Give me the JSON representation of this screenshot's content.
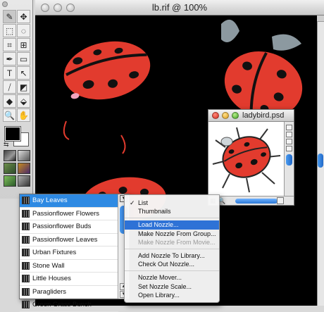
{
  "document_window": {
    "title": "lb.rif @ 100%"
  },
  "ladybird_window": {
    "title": "ladybird.psd"
  },
  "toolbox": {
    "tools": [
      "brush-icon",
      "move-icon",
      "marquee-icon",
      "lasso-icon",
      "crop-icon",
      "transform-icon",
      "pen-icon",
      "shape-icon",
      "text-icon",
      "arrow-icon",
      "eyedropper-icon",
      "eraser-icon",
      "shield-icon",
      "bucket-icon",
      "zoom-icon",
      "hand-icon"
    ],
    "tool_glyphs": [
      "✎",
      "✥",
      "⬚",
      "◌",
      "⌗",
      "⊞",
      "✒",
      "▭",
      "T",
      "↖",
      "⧸",
      "◩",
      "◆",
      "⬙",
      "🔍",
      "✋"
    ],
    "foreground_color": "#000000",
    "background_color": "#ffffff"
  },
  "nozzle_list": {
    "items": [
      "Bay Leaves",
      "Passionflower Flowers",
      "Passionflower Buds",
      "Passionflower Leaves",
      "Urban Fixtures",
      "Stone Wall",
      "Little Houses",
      "Paragliders",
      "Green Grass Bunch"
    ],
    "selected": "Bay Leaves",
    "menu_button": "▾",
    "scroll_up": "▴",
    "scroll_down": "▾"
  },
  "context_menu": {
    "check_glyph": "✓",
    "groups": [
      [
        {
          "label": "List",
          "checked": true,
          "state": "normal"
        },
        {
          "label": "Thumbnails",
          "checked": false,
          "state": "normal"
        }
      ],
      [
        {
          "label": "Load Nozzle...",
          "checked": false,
          "state": "highlighted"
        },
        {
          "label": "Make Nozzle From Group...",
          "checked": false,
          "state": "normal"
        },
        {
          "label": "Make Nozzle From Movie...",
          "checked": false,
          "state": "disabled"
        }
      ],
      [
        {
          "label": "Add Nozzle To Library...",
          "checked": false,
          "state": "normal"
        },
        {
          "label": "Check Out Nozzle...",
          "checked": false,
          "state": "normal"
        }
      ],
      [
        {
          "label": "Nozzle Mover...",
          "checked": false,
          "state": "normal"
        },
        {
          "label": "Set Nozzle Scale...",
          "checked": false,
          "state": "normal"
        },
        {
          "label": "Open Library...",
          "checked": false,
          "state": "normal"
        }
      ]
    ]
  },
  "colors": {
    "ladybug_red": "#e23b2e",
    "selection_blue": "#2e8ae3",
    "menu_highlight": "#2e72d6"
  }
}
